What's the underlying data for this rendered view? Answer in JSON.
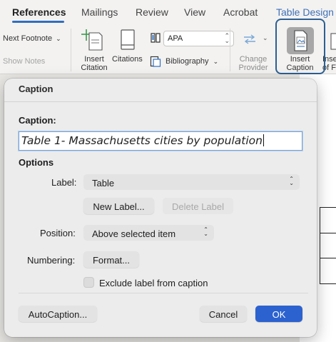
{
  "ribbon": {
    "tabs": [
      {
        "label": "References"
      },
      {
        "label": "Mailings"
      },
      {
        "label": "Review"
      },
      {
        "label": "View"
      },
      {
        "label": "Acrobat"
      },
      {
        "label": "Table Design"
      }
    ],
    "next_footnote": "Next Footnote",
    "show_notes": "Show Notes",
    "insert_citation": [
      "Insert",
      "Citation"
    ],
    "citations": "Citations",
    "style_value": "APA",
    "bibliography": "Bibliography",
    "change_provider": [
      "Change",
      "Provider"
    ],
    "insert_caption": [
      "Insert",
      "Caption"
    ],
    "insert_partial": [
      "Inser",
      "of F"
    ]
  },
  "dialog": {
    "title": "Caption",
    "caption_label": "Caption:",
    "caption_value": "Table 1- Massachusetts cities by population",
    "options_label": "Options",
    "label_label": "Label:",
    "label_value": "Table",
    "new_label_button": "New Label...",
    "delete_label_button": "Delete Label",
    "position_label": "Position:",
    "position_value": "Above selected item",
    "numbering_label": "Numbering:",
    "format_button": "Format...",
    "exclude_label": "Exclude label from caption",
    "exclude_checked": false,
    "autocaption_button": "AutoCaption...",
    "cancel_button": "Cancel",
    "ok_button": "OK"
  },
  "colors": {
    "accent_tab": "#3f72b8",
    "primary_button": "#2c62cf",
    "highlight_border": "#2c5f93"
  }
}
